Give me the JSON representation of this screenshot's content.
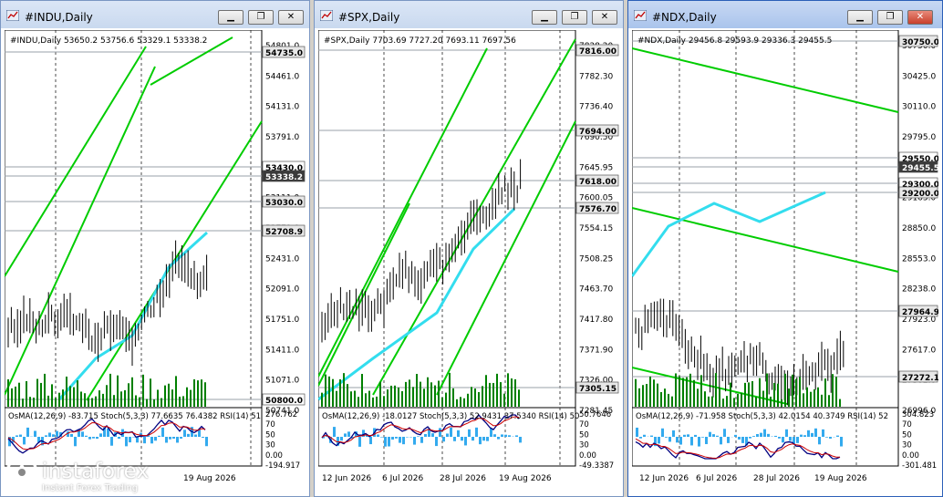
{
  "windows": [
    {
      "title": "#INDU,Daily",
      "info_line": "#INDU,Daily  53650.2 53756.6 53329.1 53338.2",
      "price_labels": [
        "54801.0",
        "54461.0",
        "54131.0",
        "53791.0",
        "53451.0",
        "53111.0",
        "52771.0",
        "52431.0",
        "52091.0",
        "51751.0",
        "51411.0",
        "51071.0",
        "50741.0"
      ],
      "level_tags": [
        {
          "text": "54735.0",
          "style": "gray"
        },
        {
          "text": "53430.0",
          "style": "white"
        },
        {
          "text": "53338.2",
          "style": "dark"
        },
        {
          "text": "53030.0",
          "style": "gray"
        },
        {
          "text": "52708.9",
          "style": "gray"
        },
        {
          "text": "50800.0",
          "style": "white"
        }
      ],
      "osc_line": "OsMA(12,26,9) -83.715  Stoch(5,3,3) 77.6635 76.4382  RSI(14) 51",
      "osc_labels": [
        "276.762",
        "70",
        "50",
        "30",
        "0.00",
        "-194.917"
      ],
      "date_labels": [
        "19 Aug 2026"
      ]
    },
    {
      "title": "#SPX,Daily",
      "info_line": "#SPX,Daily  7703.69 7727.20 7693.11 7697.56",
      "price_labels": [
        "7828.20",
        "7782.30",
        "7736.40",
        "7690.50",
        "7645.95",
        "7600.05",
        "7554.15",
        "7508.25",
        "7463.70",
        "7417.80",
        "7371.90",
        "7326.00",
        "7281.45"
      ],
      "level_tags": [
        {
          "text": "7816.00",
          "style": "gray"
        },
        {
          "text": "7694.00",
          "style": "gray"
        },
        {
          "text": "7618.00",
          "style": "gray"
        },
        {
          "text": "7576.70",
          "style": "gray"
        },
        {
          "text": "7305.15",
          "style": "gray"
        }
      ],
      "osc_line": "OsMA(12,26,9) -18.0127  Stoch(5,3,3) 52.9431 37.5340  RSI(14) 50",
      "osc_labels": [
        "50.7646",
        "70",
        "50",
        "30",
        "0.00",
        "-49.3387"
      ],
      "date_labels": [
        "12 Jun 2026",
        "6 Jul 2026",
        "28 Jul 2026",
        "19 Aug 2026"
      ]
    },
    {
      "title": "#NDX,Daily",
      "info_line": "#NDX,Daily  29456.8 29593.9 29336.3 29455.5",
      "price_labels": [
        "30750.0",
        "30425.0",
        "30110.0",
        "29795.0",
        "29480.0",
        "29165.0",
        "28850.0",
        "28553.0",
        "28238.0",
        "27923.0",
        "27617.0",
        "27302.0",
        "26996.0"
      ],
      "level_tags": [
        {
          "text": "30750.0",
          "style": "gray"
        },
        {
          "text": "29550.0",
          "style": "white"
        },
        {
          "text": "29455.5",
          "style": "dark"
        },
        {
          "text": "29300.0",
          "style": "white"
        },
        {
          "text": "29200.0",
          "style": "gray"
        },
        {
          "text": "27964.9",
          "style": "gray"
        },
        {
          "text": "27272.1",
          "style": "gray"
        }
      ],
      "osc_line": "OsMA(12,26,9) -71.958  Stoch(5,3,3) 42.0154 40.3749  RSI(14) 52",
      "osc_labels": [
        "304.823",
        "70",
        "50",
        "30",
        "0.00",
        "-301.481"
      ],
      "date_labels": [
        "12 Jun 2026",
        "6 Jul 2026",
        "28 Jul 2026",
        "19 Aug 2026"
      ]
    }
  ],
  "buttons": {
    "minimize": "▁",
    "restore": "❐",
    "close": "✕"
  },
  "watermark": {
    "name": "instaforex",
    "tagline": "Instant Forex Trading"
  },
  "colors": {
    "trend": "#00cc00",
    "ma": "#33ddee",
    "volume": "#008000",
    "osma": "#33aaee",
    "stoch_main": "#000080",
    "stoch_signal": "#cc0000"
  }
}
